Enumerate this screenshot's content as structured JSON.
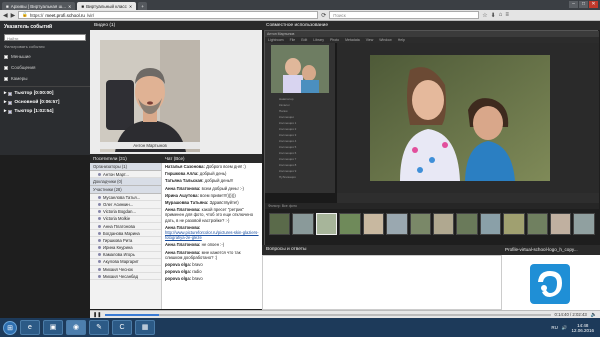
{
  "browser": {
    "tabs": [
      {
        "label": "Архивы | Виртуальная ш...",
        "active": false
      },
      {
        "label": "Виртуальный класс",
        "active": true
      }
    ],
    "new_tab": "+",
    "url_prefix": "https://",
    "url_host": "meet.profi.school.ru",
    "url_path": "/vir/",
    "search_placeholder": "Поиск"
  },
  "left_panel": {
    "title": "Указатель событий",
    "search_placeholder": "Найти",
    "filter_label": "Фильтровать события",
    "items": [
      "Меньшие",
      "Сообщения",
      "Камеры"
    ],
    "rooms": [
      {
        "label": "Тьютор [0:00:00]"
      },
      {
        "label": "Основной [0:06:57]"
      },
      {
        "label": "Тьютор [1:02:54]"
      }
    ]
  },
  "video": {
    "header": "Видео",
    "count": "(1)",
    "presenter_name": "Антон Мартынов"
  },
  "share": {
    "header": "Совместное использование",
    "lr_title": "Антон Мартынов"
  },
  "lightroom": {
    "menu": [
      "Lightroom",
      "File",
      "Edit",
      "Library",
      "Photo",
      "Metadata",
      "View",
      "Window",
      "Help"
    ],
    "left_rows": [
      "Навигатор",
      "Каталог",
      "Папки",
      "Коллекции",
      "Коллекция 1",
      "Коллекция 2",
      "Коллекция 3",
      "Коллекция 4",
      "Коллекция 5",
      "Коллекция 6",
      "Коллекция 7",
      "Коллекция 8",
      "Коллекция 9",
      "Публикация"
    ],
    "filmstrip_label": "Фильтр: Все фото",
    "thumb_colors": [
      "#5a6a4a",
      "#8a9a9a",
      "#a7b59a",
      "#6f8a5a",
      "#c8b8a0",
      "#9aa8b0",
      "#7a8868",
      "#b0a890",
      "#6a7a5a",
      "#8aa0a8",
      "#a0a070",
      "#708060",
      "#c0b0a0",
      "#90a0a0"
    ]
  },
  "attendees": {
    "header": "Посетители",
    "count": "(31)",
    "groups": [
      {
        "name": "Организаторы (1)",
        "people": [
          "Антон Март..."
        ]
      },
      {
        "name": "Докладчики (0)",
        "people": []
      },
      {
        "name": "Участники (28)",
        "people": [
          "Мусаелова Татья...",
          "Олег Асинкин...",
          "Victoria Bogdan...",
          "Victoria Molkie",
          "Анна Платонова",
          "Богдановa Марина",
          "Гиршкова Рита",
          "Ирина Кнурина",
          "Камалова Игорь",
          "Акулова Маргарит",
          "Михаил Чеснок",
          "Михаил Чесанбад"
        ]
      }
    ]
  },
  "chat": {
    "header": "Чат",
    "tab": "(Все)",
    "messages": [
      {
        "author": "Наталья Сазонова:",
        "text": "Доброго всем дня! :)"
      },
      {
        "author": "Гиршкова Алла:",
        "text": "добрый день)"
      },
      {
        "author": "Татьяна Тальская:",
        "text": "добрый день!!!"
      },
      {
        "author": "Анна Платонова:",
        "text": "всем добрый день! :-)"
      },
      {
        "author": "Ирина Ашутова:",
        "text": "всем привет!!!))))))"
      },
      {
        "author": "Мурашовва Татьяна:",
        "text": "Здравствуйте!)"
      },
      {
        "author": "Анна Платонова:",
        "text": "какой пресет \"ретрик\" применен для фото, чтоб это еще отключено дать, в не разовой настройке? :-)"
      },
      {
        "author": "Анна Платонова:",
        "link": "http://www.pictureforcolor.ru/pictures-skin-glaziers-fotografiya-ze-gleze"
      },
      {
        "author": "Анна Платонова:",
        "text": "не опоен :-)"
      },
      {
        "author": "Анна Платонова:",
        "text": "мне кажется что так слишком дообработано? :)"
      },
      {
        "author": "popova olga:",
        "text": "bravo"
      },
      {
        "author": "popova olga:",
        "text": "radio"
      },
      {
        "author": "popova olga:",
        "text": "bravo"
      }
    ]
  },
  "qa": {
    "header": "Вопросы и ответы"
  },
  "pod": {
    "header": "Profile-virtual-school-logo_h_copy..."
  },
  "player": {
    "time": "0:14:40 / 2:02:43",
    "progress": 0.12
  },
  "taskbar": {
    "clock_time": "14:48",
    "clock_date": "12.06.2016",
    "lang": "RU",
    "apps": [
      "e",
      "▣",
      "◉",
      "✎",
      "C",
      "▦"
    ]
  },
  "colors": {
    "accent": "#3a7bd5",
    "header_dark": "#2a2a2a",
    "taskbar": "#1d3a5a"
  }
}
